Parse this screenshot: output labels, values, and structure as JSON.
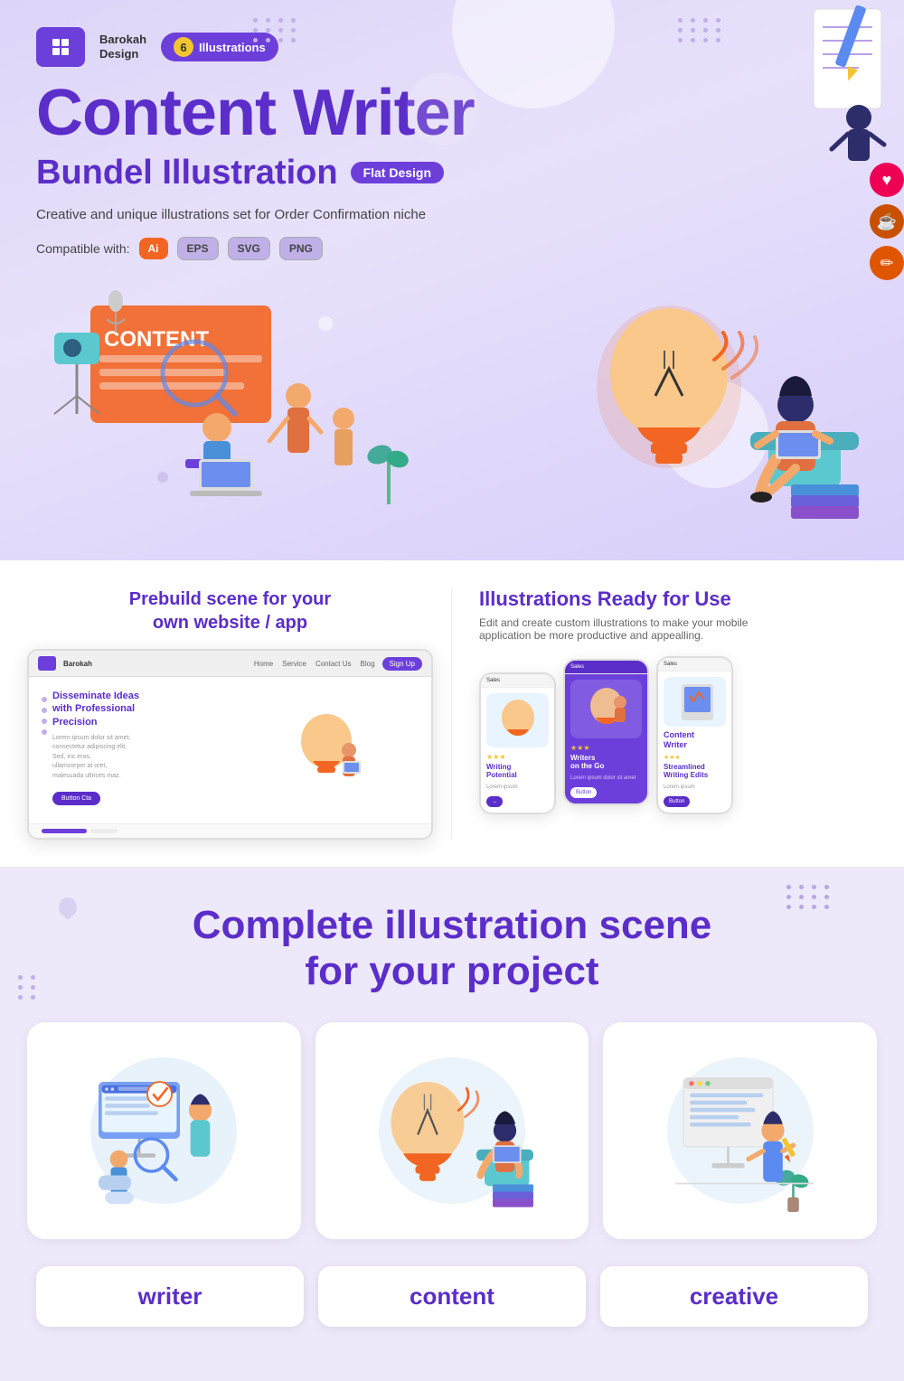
{
  "brand": {
    "name_line1": "Barokah",
    "name_line2": "Design",
    "badge_count": "6",
    "badge_label": "Illustrations"
  },
  "hero": {
    "title": "Content Writer",
    "subtitle": "Bundel Illustration",
    "flat_label": "Flat Design",
    "description": "Creative and unique illustrations set for Order Confirmation niche",
    "compat_label": "Compatible with:",
    "compat_items": [
      "Ai",
      "EPS",
      "SVG",
      "PNG"
    ]
  },
  "features": {
    "left_title": "Prebuild scene for your\nown website / app",
    "right_title": "Illustrations Ready for Use",
    "right_desc": "Edit and create custom illustrations to make your mobile\napplication be more productive and appealling.",
    "mockup": {
      "brand": "Barokah",
      "nav_items": [
        "Home",
        "Service",
        "Contact Us",
        "Blog"
      ],
      "cta": "Sign Up",
      "body_title": "Disseminate Ideas\nwith Professional\nPrecision",
      "body_text": "Lorem ipsum dolor sit amet,\nconsecteur adipiscing elit,\nSed, ine eros,\nullamcorper at oret,\nmalesuada ultrices maz.",
      "body_cta": "Button Cta"
    },
    "phones": [
      {
        "header": "Sales",
        "title": "Writing\nPotential",
        "stars": "★★★",
        "text": "Lorem ipsum",
        "cta": "Button"
      },
      {
        "header": "Sales",
        "title": "Writers\non the Go",
        "stars": "★★★",
        "text": "Lorem ipsum dolor sit amet",
        "cta": "Button"
      },
      {
        "header": "Sales",
        "title": "Content\nWriter",
        "subtitle": "Streamlined\nWriting Edits",
        "stars": "★★★",
        "text": "Lorem ipsum",
        "cta": "Button"
      }
    ]
  },
  "complete": {
    "title_line1": "Complete illustration scene",
    "title_line2": "for your project"
  },
  "tags": [
    {
      "label": "writer"
    },
    {
      "label": "content"
    },
    {
      "label": "creative"
    }
  ],
  "colors": {
    "purple_dark": "#5b2dc9",
    "purple_mid": "#6c3fdb",
    "purple_light": "#ede8fa",
    "orange": "#f26522",
    "yellow": "#f4c430",
    "teal": "#5bc8d0"
  },
  "social_icons": [
    {
      "name": "heart",
      "symbol": "♥",
      "color": "#e00055"
    },
    {
      "name": "coffee",
      "symbol": "☕",
      "color": "#c85000"
    },
    {
      "name": "pencil",
      "symbol": "✏",
      "color": "#e05500"
    }
  ]
}
